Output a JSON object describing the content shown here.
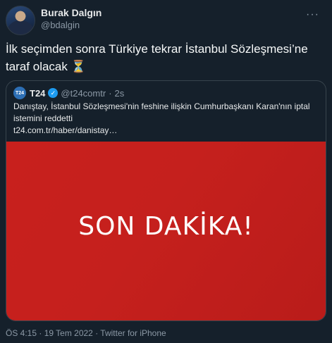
{
  "author": {
    "name": "Burak Dalgın",
    "handle": "@bdalgin"
  },
  "more_label": "···",
  "tweet": {
    "text": "İlk seçimden sonra Türkiye tekrar İstanbul Sözleşmesi’ne taraf olacak",
    "emoji": "⏳"
  },
  "quote": {
    "logo_text": "T24",
    "name": "T24",
    "handle": "@t24comtr",
    "separator": "·",
    "time": "2s",
    "text": "Danıştay, İstanbul Sözleşmesi'nin feshine ilişkin Cumhurbaşkanı Karan'nın iptal istemini reddetti",
    "link": "t24.com.tr/haber/danistay…",
    "media_text": "SON DAKİKA!"
  },
  "footer": {
    "text": "ÖS 4:15 · 19 Tem 2022 · Twitter for iPhone"
  },
  "colors": {
    "background": "#15202b",
    "media": "#c8201d",
    "verified": "#1d9bf0"
  }
}
